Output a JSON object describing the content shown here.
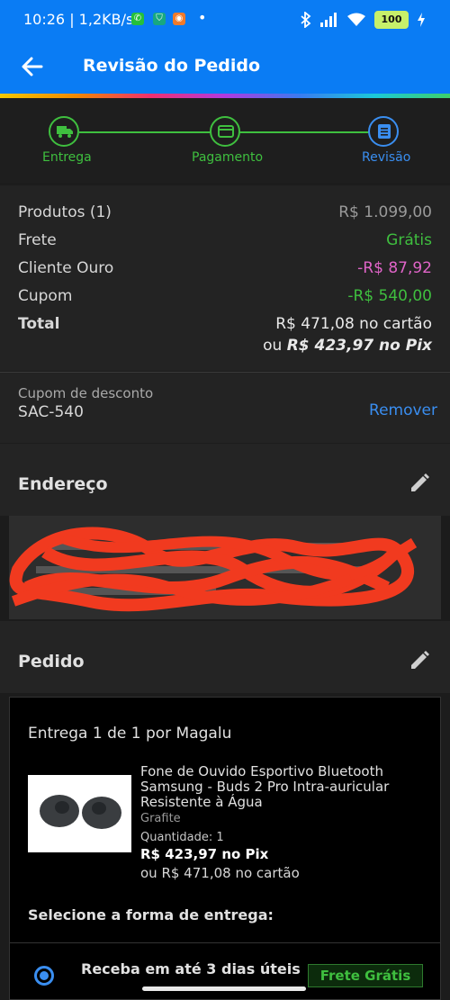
{
  "status_bar": {
    "time_speed": "10:26 | 1,2KB/s",
    "dot": "•",
    "battery": "100"
  },
  "header": {
    "title": "Revisão do Pedido"
  },
  "steps": [
    {
      "label": "Entrega"
    },
    {
      "label": "Pagamento"
    },
    {
      "label": "Revisão"
    }
  ],
  "summary": {
    "products_label": "Produtos (1)",
    "products_value": "R$ 1.099,00",
    "shipping_label": "Frete",
    "shipping_value": "Grátis",
    "gold_label": "Cliente Ouro",
    "gold_value": "-R$ 87,92",
    "coupon_label": "Cupom",
    "coupon_value": "-R$ 540,00",
    "total_label": "Total",
    "total_card": "R$ 471,08 no cartão",
    "total_pix_prefix": "ou ",
    "total_pix": "R$ 423,97 no Pix"
  },
  "coupon": {
    "label": "Cupom de desconto",
    "code": "SAC-540",
    "remove": "Remover"
  },
  "address": {
    "title": "Endereço"
  },
  "order": {
    "title": "Pedido",
    "delivery_header": "Entrega 1 de 1 por Magalu",
    "product_name": "Fone de Ouvido Esportivo Bluetooth Samsung - Buds 2 Pro Intra-auricular Resistente à Água",
    "variant": "Grafite",
    "quantity": "Quantidade:  1",
    "price_pix": "R$ 423,97 no Pix",
    "price_card": "ou R$ 471,08 no cartão",
    "select_delivery": "Selecione a forma de entrega:",
    "delivery_option": "Receba em até 3 dias úteis",
    "free_badge": "Frete Grátis"
  },
  "colors": {
    "brand_blue": "#0a7cf4",
    "success_green": "#3fbf3f",
    "discount_pink": "#e064c8",
    "link_blue": "#3a8ef0"
  }
}
